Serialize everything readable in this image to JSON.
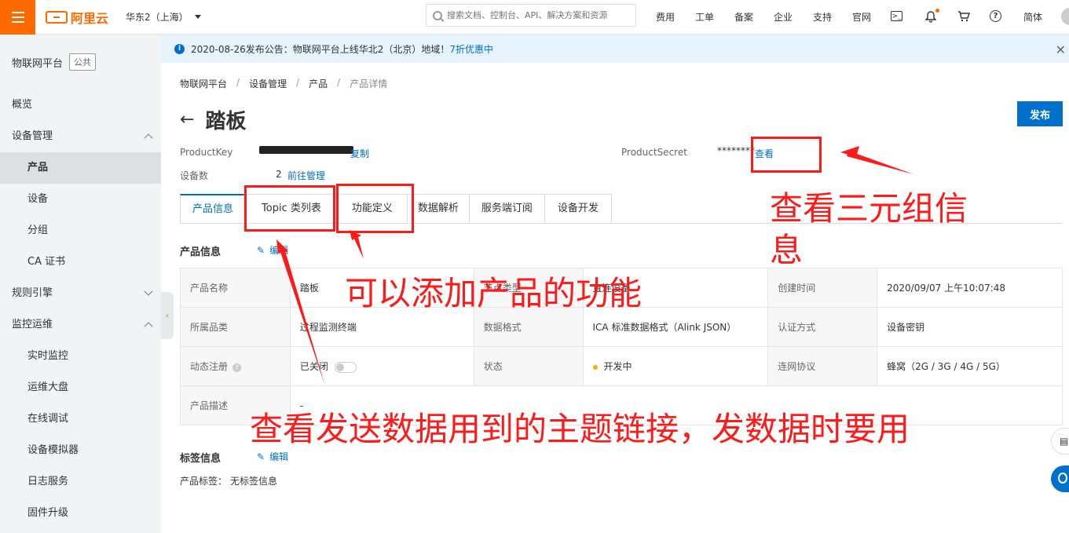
{
  "topbar": {
    "logo_text": "阿里云",
    "region": "华东2（上海）",
    "search_placeholder": "搜索文档、控制台、API、解决方案和资源",
    "links": [
      "费用",
      "工单",
      "备案",
      "企业",
      "支持",
      "官网"
    ],
    "lang": "简体",
    "icons": [
      "terminal-icon",
      "bell-icon",
      "cart-icon",
      "help-icon"
    ],
    "accent": "#ff6a00"
  },
  "sidebar": {
    "title": "物联网平台",
    "badge": "公共",
    "items": [
      {
        "label": "概览",
        "level": 1
      },
      {
        "label": "设备管理",
        "level": 1,
        "expanded": true
      },
      {
        "label": "产品",
        "level": 2,
        "active": true
      },
      {
        "label": "设备",
        "level": 2
      },
      {
        "label": "分组",
        "level": 2
      },
      {
        "label": "CA 证书",
        "level": 2
      },
      {
        "label": "规则引擎",
        "level": 1,
        "expanded": false
      },
      {
        "label": "监控运维",
        "level": 1,
        "expanded": true
      },
      {
        "label": "实时监控",
        "level": 2
      },
      {
        "label": "运维大盘",
        "level": 2
      },
      {
        "label": "在线调试",
        "level": 2
      },
      {
        "label": "设备模拟器",
        "level": 2
      },
      {
        "label": "日志服务",
        "level": 2
      },
      {
        "label": "固件升级",
        "level": 2
      }
    ]
  },
  "notice": {
    "text": "2020-08-26发布公告：物联网平台上线华北2（北京）地域！",
    "link": "7折优惠中"
  },
  "breadcrumb": [
    "物联网平台",
    "设备管理",
    "产品",
    "产品详情"
  ],
  "page": {
    "title": "踏板",
    "publish": "发布",
    "product_key_label": "ProductKey",
    "product_key_action": "复制",
    "product_secret_label": "ProductSecret",
    "product_secret_value": "********",
    "product_secret_action": "查看",
    "device_count_label": "设备数",
    "device_count_value": "2",
    "device_count_action": "前往管理"
  },
  "tabs": [
    "产品信息",
    "Topic 类列表",
    "功能定义",
    "数据解析",
    "服务端订阅",
    "设备开发"
  ],
  "product_info": {
    "section_title": "产品信息",
    "edit_label": "编辑",
    "rows": [
      [
        {
          "label": "产品名称",
          "value": "踏板"
        },
        {
          "label": "节点类型",
          "value": "直连设备"
        },
        {
          "label": "创建时间",
          "value": "2020/09/07 上午10:07:48"
        }
      ],
      [
        {
          "label": "所属品类",
          "value": "过程监测终端"
        },
        {
          "label": "数据格式",
          "value": "ICA 标准数据格式（Alink JSON）"
        },
        {
          "label": "认证方式",
          "value": "设备密钥"
        }
      ],
      [
        {
          "label": "动态注册",
          "value": "已关闭"
        },
        {
          "label": "状态",
          "value": "开发中"
        },
        {
          "label": "连网协议",
          "value": "蜂窝（2G / 3G / 4G / 5G）"
        }
      ],
      [
        {
          "label": "产品描述",
          "value": "-"
        }
      ]
    ]
  },
  "tag_info": {
    "section_title": "标签信息",
    "edit_label": "编辑",
    "tag_label": "产品标签：",
    "tag_value": "无标签信息"
  },
  "annotations": {
    "triple_info": "查看三元组信\n息",
    "add_function": "可以添加产品的功能",
    "topic_link": "查看发送数据用到的主题链接，发数据时要用",
    "color": "#ff1a1a"
  }
}
